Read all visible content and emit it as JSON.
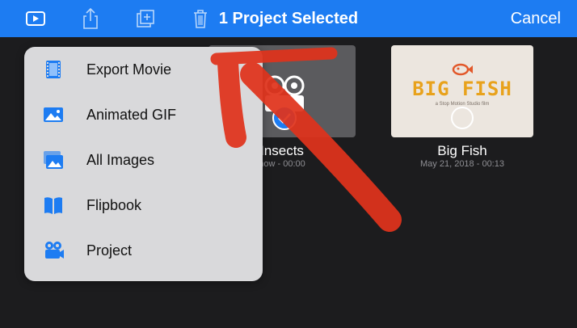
{
  "header": {
    "title": "1 Project Selected",
    "cancel_label": "Cancel"
  },
  "toolbar_icons": [
    "play-icon",
    "share-icon",
    "duplicate-icon",
    "trash-icon"
  ],
  "projects": [
    {
      "name": "Insects",
      "date": "now - 00:00",
      "selected": true
    },
    {
      "name": "Big Fish",
      "date": "May 21, 2018 - 00:13",
      "selected": false
    }
  ],
  "bigfish_thumb": {
    "logo_text": "BIG FISH",
    "tagline": "a Stop Motion Studio film"
  },
  "menu": {
    "items": [
      {
        "label": "Export Movie",
        "icon": "film-icon"
      },
      {
        "label": "Animated GIF",
        "icon": "image-icon"
      },
      {
        "label": "All Images",
        "icon": "images-icon"
      },
      {
        "label": "Flipbook",
        "icon": "book-icon"
      },
      {
        "label": "Project",
        "icon": "video-camera-icon"
      }
    ]
  },
  "colors": {
    "accent": "#1d7cf2",
    "annotation": "#e0331c"
  }
}
